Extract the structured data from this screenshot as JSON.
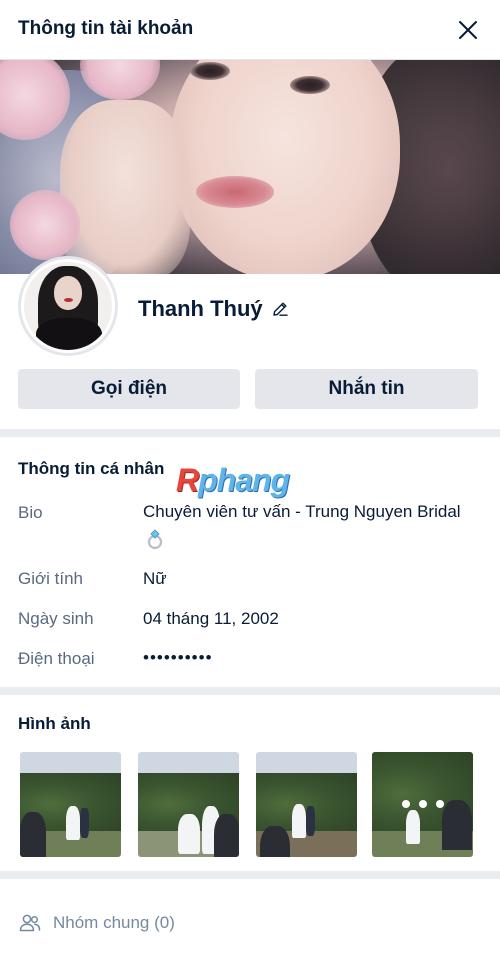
{
  "header": {
    "title": "Thông tin tài khoản"
  },
  "profile": {
    "name": "Thanh Thuý"
  },
  "actions": {
    "call_label": "Gọi điện",
    "message_label": "Nhắn tin"
  },
  "watermark": {
    "r": "R",
    "rest": "phang"
  },
  "personal_info": {
    "title": "Thông tin cá nhân",
    "fields": [
      {
        "label": "Bio",
        "value": "Chuyên viên tư vấn - Trung Nguyen Bridal"
      },
      {
        "label": "Giới tính",
        "value": "Nữ"
      },
      {
        "label": "Ngày sinh",
        "value": "04 tháng 11, 2002"
      },
      {
        "label": "Điện thoại",
        "value": "••••••••••"
      }
    ]
  },
  "photos": {
    "title": "Hình ảnh"
  },
  "groups": {
    "label": "Nhóm chung (0)"
  },
  "icons": [
    "close-icon",
    "edit-pencil-icon",
    "ring-emoji-icon",
    "group-icon",
    "more-dots-icon"
  ],
  "colors": {
    "text": "#081c36",
    "label": "#5a6981",
    "button_bg": "#e4e6eb",
    "divider": "#e9ecf1"
  }
}
